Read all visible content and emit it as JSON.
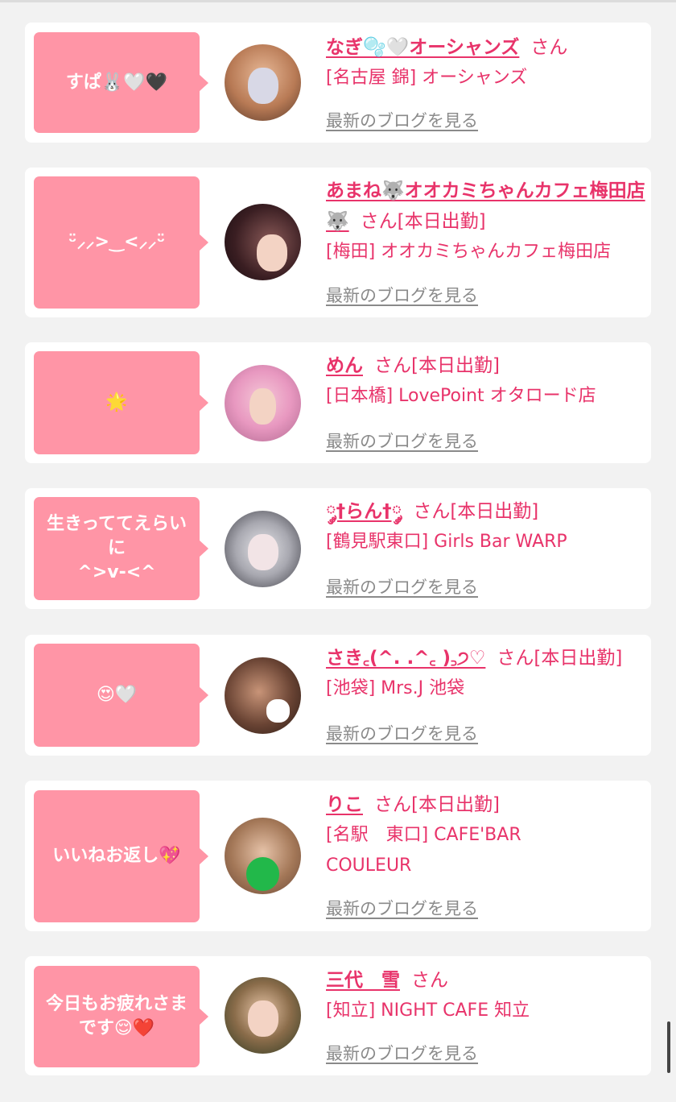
{
  "entries": [
    {
      "bubble": "すぱ🐰🤍🖤",
      "name": "なぎ🫧🤍オーシャンズ",
      "san": "さん",
      "status": "",
      "shop": "[名古屋 錦] オーシャンズ",
      "blog_link": "最新のブログを見る"
    },
    {
      "bubble": "ᵕ̈⸝⸝>‿<⸝⸝ᵕ̈",
      "name": "あまね🐺オオカミちゃんカフェ梅田店🐺",
      "san": "さん",
      "status": "[本日出勤]",
      "shop": "[梅田] オオカミちゃんカフェ梅田店",
      "blog_link": "最新のブログを見る"
    },
    {
      "bubble": "🌟",
      "name": "めん",
      "san": "さん",
      "status": "[本日出勤]",
      "shop": "[日本橋] LovePoint オタロード店",
      "blog_link": "最新のブログを見る"
    },
    {
      "bubble": "生きっててえらいに\n^>v-<^",
      "name": "༘†らん†༘",
      "san": "さん",
      "status": "[本日出勤]",
      "shop": "[鶴見駅東口] Girls Bar WARP",
      "blog_link": "最新のブログを見る"
    },
    {
      "bubble": "😍🤍",
      "name": "さき꜀(^. .^꜀ )꜆੭♡",
      "san": "さん",
      "status": "[本日出勤]",
      "shop": "[池袋] Mrs.J 池袋",
      "blog_link": "最新のブログを見る"
    },
    {
      "bubble": "いいねお返し💖",
      "name": "りこ",
      "san": "さん",
      "status": "[本日出勤]",
      "shop": "[名駅　東口] CAFE'BAR COULEUR",
      "blog_link": "最新のブログを見る"
    },
    {
      "bubble": "今日もお疲れさま\nです😌❤️",
      "name": "三代　雪",
      "san": "さん",
      "status": "",
      "shop": "[知立] NIGHT CAFE 知立",
      "blog_link": "最新のブログを見る"
    }
  ],
  "colors": {
    "page_bg": "#f2f2f2",
    "card_bg": "#ffffff",
    "bubble_bg": "#ff95a6",
    "accent_pink": "#e8336a",
    "link_gray": "#8a8a8a"
  }
}
